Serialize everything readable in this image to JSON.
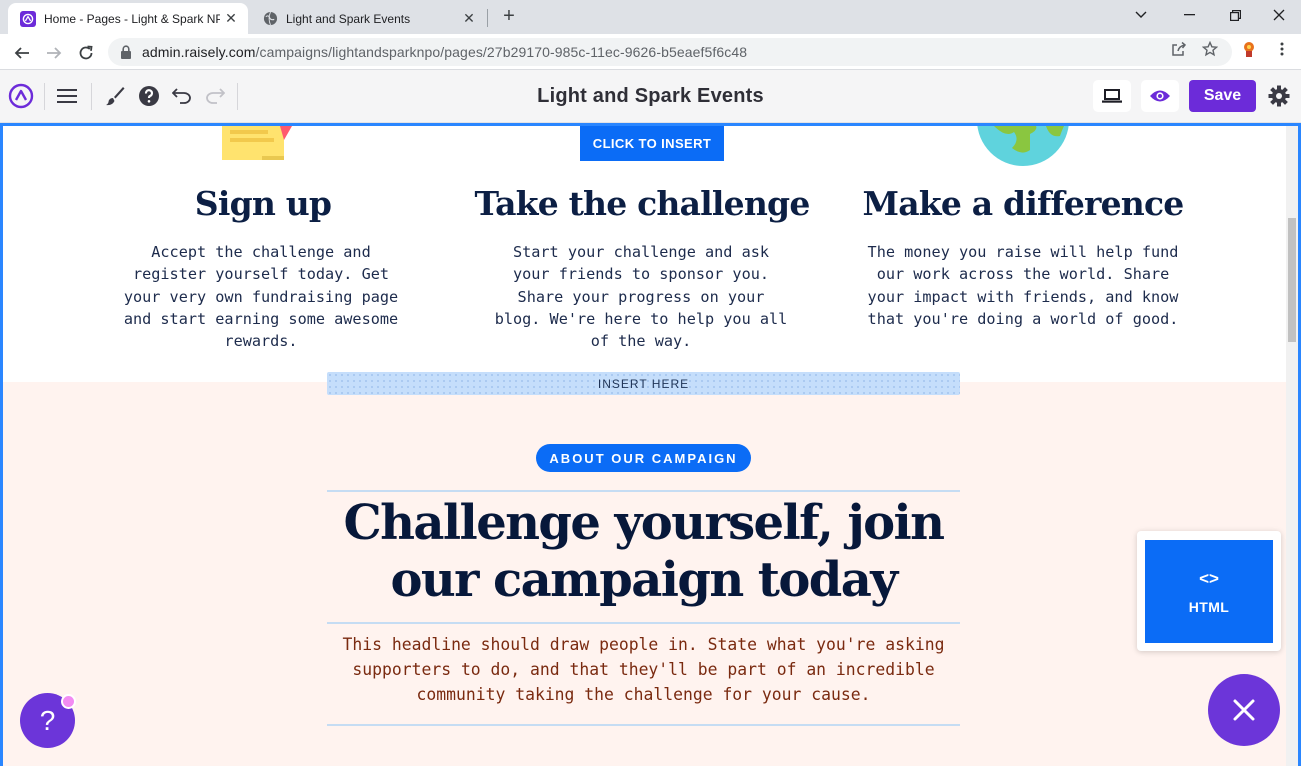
{
  "browser": {
    "tabs": [
      {
        "title": "Home - Pages - Light & Spark NPO",
        "active": true
      },
      {
        "title": "Light and Spark Events",
        "active": false
      }
    ],
    "url_host": "admin.raisely.com",
    "url_path": "/campaigns/lightandsparknpo/pages/27b29170-985c-11ec-9626-b5eaef5f6c48"
  },
  "toolbar": {
    "title": "Light and Spark Events",
    "save_label": "Save"
  },
  "canvas": {
    "click_to_insert": "CLICK TO INSERT",
    "insert_here": "INSERT HERE",
    "steps": [
      {
        "title": "Sign up",
        "text": "Accept the challenge and register yourself today. Get your very own fundraising page and start earning some awesome rewards."
      },
      {
        "title": "Take the challenge",
        "text": "Start your challenge and ask your friends to sponsor you. Share your progress on your blog. We're here to help you all of the way."
      },
      {
        "title": "Make a difference",
        "text": "The money you raise will help fund our work across the world. Share your impact with friends, and know that you're doing a world of good."
      }
    ],
    "about": {
      "pill": "ABOUT OUR CAMPAIGN",
      "headline": "Challenge yourself, join our campaign today",
      "subtext": "This headline should draw people in. State what you're asking supporters to do, and that they'll be part of an incredible community taking the challenge for your cause."
    },
    "html_block": {
      "code": "<>",
      "label": "HTML"
    },
    "help_label": "?"
  },
  "colors": {
    "brand_purple": "#6c2bd9",
    "insert_blue": "#0b6cf6",
    "canvas_border": "#2a86ff",
    "about_bg": "#fff3ef",
    "headline_navy": "#07183a"
  }
}
